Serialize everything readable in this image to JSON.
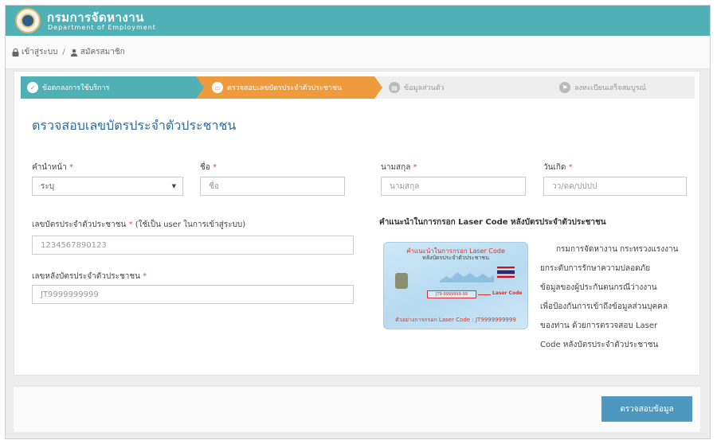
{
  "header": {
    "title_th": "กรมการจัดหางาน",
    "title_en": "Department of Employment"
  },
  "breadcrumb": {
    "items": [
      {
        "label": "เข้าสู่ระบบ",
        "icon": "lock-icon"
      },
      {
        "label": "สมัครสมาชิก",
        "icon": "user-icon"
      }
    ],
    "separator": "/"
  },
  "steps": [
    {
      "label": "ข้อตกลงการใช้บริการ",
      "state": "done",
      "color": "#4fb0b5"
    },
    {
      "label": "ตรวจสอบเลขบัตรประจำตัวประชาชน",
      "state": "active",
      "color": "#ef9a3c"
    },
    {
      "label": "ข้อมูลส่วนตัว",
      "state": "pending"
    },
    {
      "label": "ลงทะเบียนเสร็จสมบูรณ์",
      "state": "pending"
    }
  ],
  "form": {
    "title": "ตรวจสอบเลขบัตรประจำตัวประชาชน",
    "required_mark": "*",
    "prefix": {
      "label": "คำนำหน้า",
      "value": "ระบุ"
    },
    "first_name": {
      "label": "ชื่อ",
      "placeholder": "ชื่อ"
    },
    "last_name": {
      "label": "นามสกุล",
      "placeholder": "นามสกุล"
    },
    "birth_date": {
      "label": "วันเกิด",
      "placeholder": "วว/ดด/ปปปป"
    },
    "id_number": {
      "label": "เลขบัตรประจำตัวประชาชน",
      "note": "(ใช้เป็น user ในการเข้าสู่ระบบ)",
      "placeholder": "1234567890123"
    },
    "laser_code": {
      "label": "เลขหลังบัตรประจำตัวประชาชน",
      "placeholder": "JT9999999999"
    }
  },
  "guide": {
    "title": "คำแนะนำในการกรอก Laser Code หลังบัตรประจำตัวประชาชน",
    "card": {
      "title": "คำแนะนำในการกรอก Laser Code",
      "subtitle": "หลังบัตรประจำตัวประชาชน",
      "code_box": "JT9-9999999-99",
      "code_label": "Laser Code",
      "footer": "ตัวอย่างการกรอก Laser Code : JT9999999999"
    },
    "lines": [
      "กรมการจัดหางาน กระทรวงแรงงาน",
      "ยกระดับการรักษาความปลอดภัย",
      "ข้อมูลของผู้ประกันตนกรณีว่างงาน",
      "เพื่อป้องกันการเข้าถึงข้อมูลส่วนบุคคล",
      "ของท่าน ด้วยการตรวจสอบ Laser",
      "Code หลังบัตรประจำตัวประชาชน"
    ]
  },
  "actions": {
    "verify_label": "ตรวจสอบข้อมูล"
  }
}
